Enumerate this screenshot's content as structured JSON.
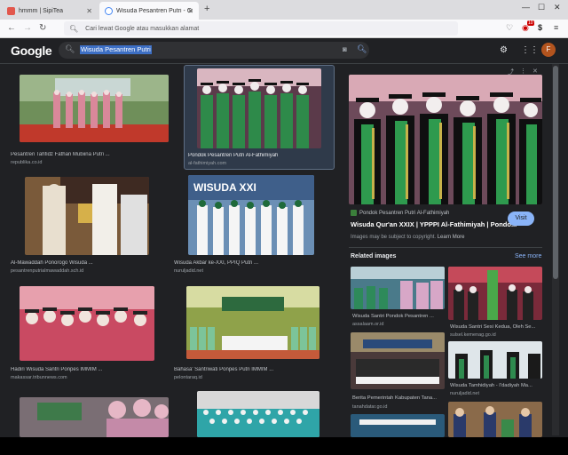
{
  "browser": {
    "tabs": [
      {
        "title": "hmmm | SipiTea"
      },
      {
        "title": "Wisuda Pesantren Putri - Google"
      }
    ],
    "new_tab": "+",
    "address_placeholder": "Cari lewat Google atau masukkan alamat",
    "extension_badge": "10"
  },
  "google": {
    "logo": "Google",
    "query": "Wisuda Pesantren Putri",
    "avatar_letter": "F"
  },
  "results": [
    {
      "caption": "Pesantren Tahfidz Fathan Mubiina Putri ...",
      "source": "republika.co.id"
    },
    {
      "caption": "Pondok Pesantren Putri Al-Fathimiyah",
      "source": "al-fathimiyah.com"
    },
    {
      "caption": "Al-Mawaddah Ponorogo Wisuda ...",
      "source": "pesantrenputrialmawaddah.sch.id"
    },
    {
      "caption": "Wisuda Akbar ke-XXI, PPIQ Putri ...",
      "source": "nuruljadid.net"
    },
    {
      "caption": "Hadiri Wisuda Santri Ponpes IMMIM ...",
      "source": "makassar.tribunnews.com"
    },
    {
      "caption": "Bahasa' Santriwati Ponpes Putri IMMIM ...",
      "source": "pelontaraq.id"
    },
    {
      "caption": "",
      "source": ""
    },
    {
      "caption": "",
      "source": ""
    }
  ],
  "image_text": {
    "wisuda_xxi": "WISUDA XXI"
  },
  "preview": {
    "site": "Pondok Pesantren Putri Al-Fathimiyah",
    "title": "Wisuda Qur'an XXIX | YPPPI Al-Fathimiyah | Pondo...",
    "visit": "Visit",
    "copyright": "Images may be subject to copyright.",
    "learn_more": "Learn More",
    "related_heading": "Related images",
    "see_more": "See more",
    "related": [
      {
        "caption": "Wisuda Santri Pondok Pesantren ...",
        "source": "assalaam.or.id"
      },
      {
        "caption": "Wisuda Santri Sesi Kedua, Oleh Se...",
        "source": "sulsel.kemenag.go.id"
      },
      {
        "caption": "Berita Pemerintah Kabupaten Tana...",
        "source": "tanahdatar.go.id"
      },
      {
        "caption": "Wisuda Tamhidiyah - I'dadiyah Ma...",
        "source": "nuruljadid.net"
      }
    ]
  }
}
